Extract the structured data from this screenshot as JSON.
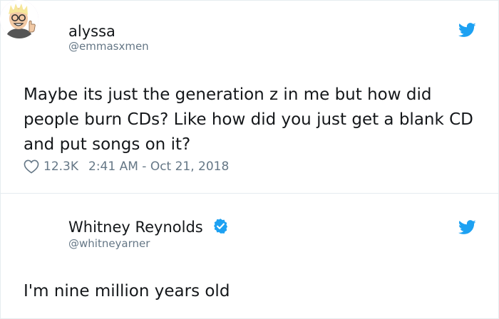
{
  "tweets": [
    {
      "display_name": "alyssa",
      "handle": "@emmasxmen",
      "avatar_icon": "she-hulk-avatar",
      "text": "Maybe its just the generation z in me but how did people burn CDs? Like how did you just get a blank CD and put songs on it?",
      "likes": "12.3K",
      "timestamp": "2:41 AM - Oct 21, 2018",
      "bird_color": "#1da1f2"
    },
    {
      "display_name": "Whitney Reynolds",
      "handle": "@whitneyarner",
      "avatar_icon": "cartoon-thumbs-up-avatar",
      "verified": true,
      "text": "I'm nine million years old",
      "bird_color": "#1da1f2"
    }
  ],
  "colors": {
    "text": "#14171a",
    "secondary": "#657786",
    "border": "#e6ecf0",
    "brand": "#1da1f2"
  }
}
